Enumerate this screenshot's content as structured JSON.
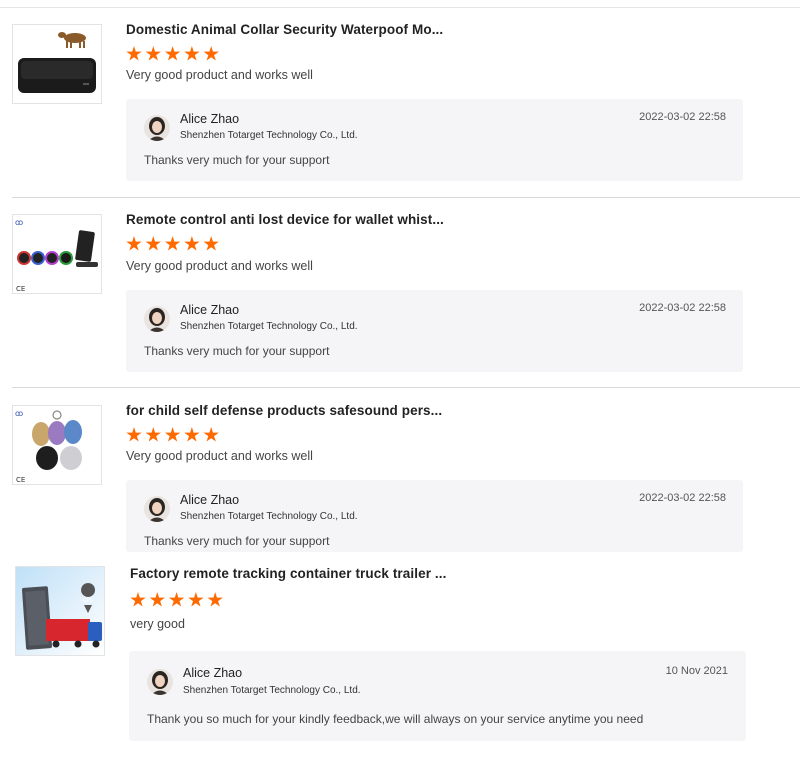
{
  "reviews": [
    {
      "product_title": "Domestic Animal Collar Security Waterpoof Mo...",
      "rating": 5,
      "comment": "Very good product and works well",
      "image": "black-gps-tracker-with-cow",
      "reply": {
        "name": "Alice Zhao",
        "company": "Shenzhen Totarget Technology Co., Ltd.",
        "date": "2022-03-02 22:58",
        "text": "Thanks very much for your support"
      }
    },
    {
      "product_title": "Remote control anti lost device for wallet whist...",
      "rating": 5,
      "comment": "Very good product and works well",
      "image": "colorful-key-finders-with-base",
      "reply": {
        "name": "Alice Zhao",
        "company": "Shenzhen Totarget Technology Co., Ltd.",
        "date": "2022-03-02 22:58",
        "text": "Thanks very much for your support"
      }
    },
    {
      "product_title": "for child self defense products safesound pers...",
      "rating": 5,
      "comment": "Very good product and works well",
      "image": "personal-alarm-keychains",
      "reply": {
        "name": "Alice Zhao",
        "company": "Shenzhen Totarget Technology Co., Ltd.",
        "date": "2022-03-02 22:58",
        "text": "Thanks very much for your support"
      }
    },
    {
      "product_title": "Factory remote tracking container truck trailer ...",
      "rating": 5,
      "comment": "very good",
      "image": "container-truck-tracker",
      "reply": {
        "name": "Alice Zhao",
        "company": "Shenzhen Totarget Technology Co., Ltd.",
        "date": "10 Nov 2021",
        "text": "Thank you so much for your kindly feedback,we will always on your service anytime you need"
      }
    }
  ],
  "colors": {
    "star": "#ff6a00",
    "reply_bg": "#f5f5f7",
    "divider": "#d9d9d9"
  }
}
